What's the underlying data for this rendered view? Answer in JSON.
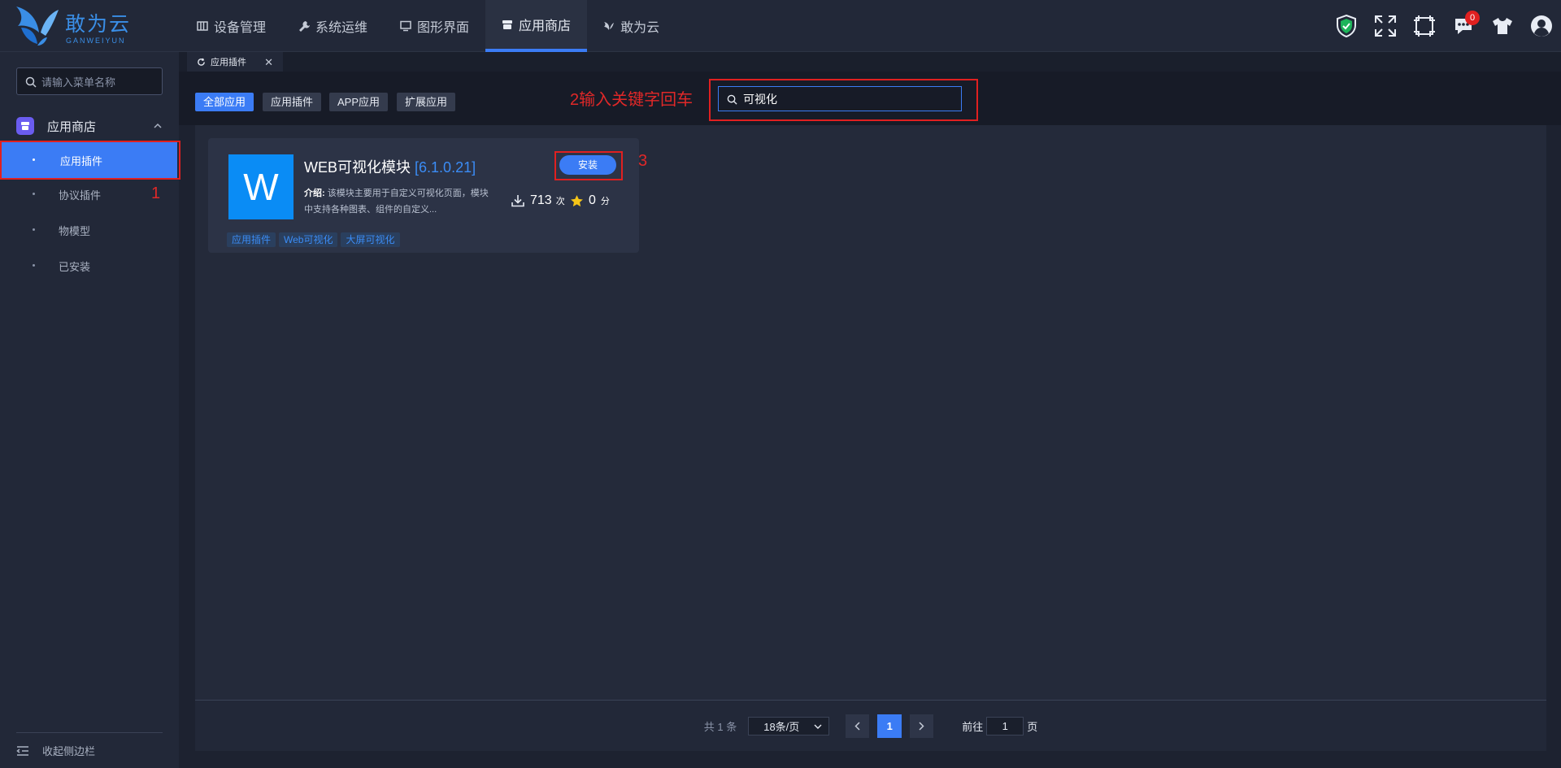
{
  "brand": {
    "title": "敢为云",
    "subtitle": "GANWEIYUN"
  },
  "nav": [
    {
      "label": "设备管理",
      "icon": "book-icon"
    },
    {
      "label": "系统运维",
      "icon": "wrench-icon"
    },
    {
      "label": "图形界面",
      "icon": "monitor-icon"
    },
    {
      "label": "应用商店",
      "icon": "store-icon",
      "active": true
    },
    {
      "label": "敢为云",
      "icon": "logo-icon"
    }
  ],
  "tools": {
    "message_count": "0"
  },
  "sidebar": {
    "search_placeholder": "请输入菜单名称",
    "group_label": "应用商店",
    "items": [
      {
        "label": "应用插件",
        "active": true
      },
      {
        "label": "协议插件"
      },
      {
        "label": "物模型"
      },
      {
        "label": "已安装"
      }
    ],
    "collapse_label": "收起侧边栏"
  },
  "tab": {
    "label": "应用插件"
  },
  "filters": [
    "全部应用",
    "应用插件",
    "APP应用",
    "扩展应用"
  ],
  "annotations": {
    "step1": "1",
    "step2": "2输入关键字回车",
    "step3": "3"
  },
  "search": {
    "value": "可视化"
  },
  "card": {
    "logo_letter": "W",
    "title": "WEB可视化模块",
    "version": "[6.1.0.21]",
    "desc_label": "介绍:",
    "desc_text": "该模块主要用于自定义可视化页面，模块中支持各种图表、组件的自定义...",
    "downloads": "713",
    "downloads_unit": "次",
    "rating": "0",
    "rating_unit": "分",
    "install_label": "安装",
    "tags": [
      "应用插件",
      "Web可视化",
      "大屏可视化"
    ]
  },
  "pager": {
    "total": "共 1 条",
    "page_size": "18条/页",
    "current": "1",
    "goto_prefix": "前往",
    "goto_value": "1",
    "goto_suffix": "页"
  },
  "colors": {
    "accent": "#3b7cf5",
    "annotation": "#e02020",
    "logo_blue": "#0a8cf5"
  }
}
